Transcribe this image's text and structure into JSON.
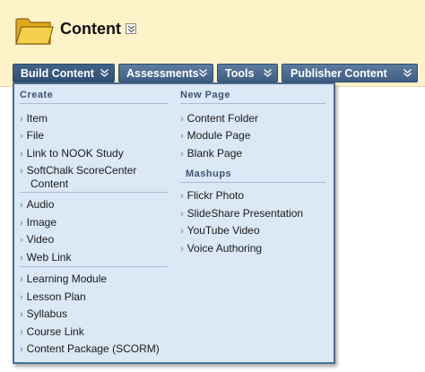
{
  "page": {
    "title": "Content",
    "folder_icon": "folder-icon",
    "header_color": "#fdf2c8"
  },
  "menu_bar": {
    "items": [
      {
        "label": "Build Content"
      },
      {
        "label": "Assessments"
      },
      {
        "label": "Tools"
      },
      {
        "label": "Publisher Content"
      }
    ],
    "color": "#4a6b91"
  },
  "dropdown": {
    "background": "#dbe8f5",
    "create": {
      "title": "Create",
      "groups": [
        [
          "Item",
          "File",
          "Link to NOOK Study",
          "SoftChalk ScoreCenter Content"
        ],
        [
          "Audio",
          "Image",
          "Video",
          "Web Link"
        ],
        [
          "Learning Module",
          "Lesson Plan",
          "Syllabus",
          "Course Link",
          "Content Package (SCORM)"
        ]
      ]
    },
    "new_page": {
      "title": "New Page",
      "items": [
        "Content Folder",
        "Module Page",
        "Blank Page"
      ]
    },
    "mashups": {
      "title": "Mashups",
      "items": [
        "Flickr Photo",
        "SlideShare Presentation",
        "YouTube Video",
        "Voice Authoring"
      ]
    }
  }
}
